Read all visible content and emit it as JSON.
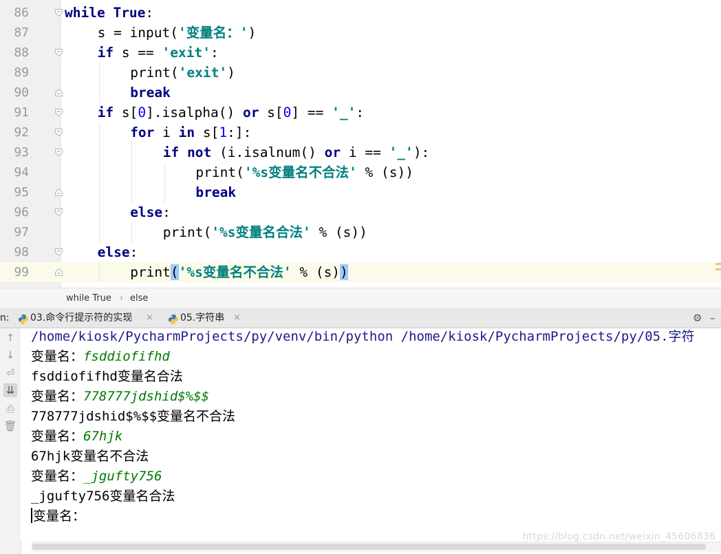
{
  "editor": {
    "current_line": 99,
    "lines": [
      {
        "no": "86",
        "indent": 0,
        "tokens": [
          [
            "kw",
            "while"
          ],
          [
            "t",
            " "
          ],
          [
            "kw",
            "True"
          ],
          [
            "t",
            ":"
          ]
        ]
      },
      {
        "no": "87",
        "indent": 1,
        "tokens": [
          [
            "t",
            "s = input("
          ],
          [
            "str",
            "'变量名：'"
          ],
          [
            "t",
            ")"
          ]
        ]
      },
      {
        "no": "88",
        "indent": 1,
        "tokens": [
          [
            "kw",
            "if"
          ],
          [
            "t",
            " s == "
          ],
          [
            "str",
            "'exit'"
          ],
          [
            "t",
            ":"
          ]
        ]
      },
      {
        "no": "89",
        "indent": 2,
        "tokens": [
          [
            "t",
            "print("
          ],
          [
            "str",
            "'exit'"
          ],
          [
            "t",
            ")"
          ]
        ]
      },
      {
        "no": "90",
        "indent": 2,
        "tokens": [
          [
            "kw",
            "break"
          ]
        ]
      },
      {
        "no": "91",
        "indent": 1,
        "tokens": [
          [
            "kw",
            "if"
          ],
          [
            "t",
            " s["
          ],
          [
            "num",
            "0"
          ],
          [
            "t",
            "].isalpha() "
          ],
          [
            "kw",
            "or"
          ],
          [
            "t",
            " s["
          ],
          [
            "num",
            "0"
          ],
          [
            "t",
            "] == "
          ],
          [
            "str",
            "'_'"
          ],
          [
            "t",
            ":"
          ]
        ]
      },
      {
        "no": "92",
        "indent": 2,
        "tokens": [
          [
            "kw",
            "for"
          ],
          [
            "t",
            " i "
          ],
          [
            "kw",
            "in"
          ],
          [
            "t",
            " s["
          ],
          [
            "num",
            "1"
          ],
          [
            "t",
            ":]:"
          ]
        ]
      },
      {
        "no": "93",
        "indent": 3,
        "tokens": [
          [
            "kw",
            "if"
          ],
          [
            "t",
            " "
          ],
          [
            "kw",
            "not"
          ],
          [
            "t",
            " (i.isalnum() "
          ],
          [
            "kw",
            "or"
          ],
          [
            "t",
            " i == "
          ],
          [
            "str",
            "'_'"
          ],
          [
            "t",
            "):"
          ]
        ]
      },
      {
        "no": "94",
        "indent": 4,
        "tokens": [
          [
            "t",
            "print("
          ],
          [
            "str",
            "'%s变量名不合法'"
          ],
          [
            "t",
            " % (s))"
          ]
        ]
      },
      {
        "no": "95",
        "indent": 4,
        "tokens": [
          [
            "kw",
            "break"
          ]
        ]
      },
      {
        "no": "96",
        "indent": 2,
        "tokens": [
          [
            "kw",
            "else"
          ],
          [
            "t",
            ":"
          ]
        ]
      },
      {
        "no": "97",
        "indent": 3,
        "tokens": [
          [
            "t",
            "print("
          ],
          [
            "str",
            "'%s变量名合法'"
          ],
          [
            "t",
            " % (s))"
          ]
        ]
      },
      {
        "no": "98",
        "indent": 1,
        "tokens": [
          [
            "kw",
            "else"
          ],
          [
            "t",
            ":"
          ]
        ]
      },
      {
        "no": "99",
        "indent": 2,
        "tokens": [
          [
            "t",
            "print"
          ],
          [
            "hl",
            "("
          ],
          [
            "str",
            "'%s变量名不合法'"
          ],
          [
            "t",
            " % (s)"
          ],
          [
            "hl",
            ")"
          ]
        ]
      }
    ]
  },
  "breadcrumb": {
    "items": [
      "while True",
      "else"
    ],
    "separator": "›"
  },
  "run_tabs": {
    "prefix": "n:",
    "tabs": [
      {
        "label": "03.命令行提示符的实现",
        "close": "×"
      },
      {
        "label": "05.字符串",
        "close": "×"
      }
    ],
    "settings_glyph": "⚙",
    "minimize_glyph": "–"
  },
  "console": {
    "lines": [
      {
        "kind": "cmd",
        "text": "/home/kiosk/PycharmProjects/py/venv/bin/python /home/kiosk/PycharmProjects/py/05.字符"
      },
      {
        "kind": "prompt",
        "text": "变量名：",
        "input": "fsddiofifhd"
      },
      {
        "kind": "out",
        "text": "fsddiofifhd变量名合法"
      },
      {
        "kind": "prompt",
        "text": "变量名：",
        "input": "778777jdshid$%$$"
      },
      {
        "kind": "out",
        "text": "778777jdshid$%$$变量名不合法"
      },
      {
        "kind": "prompt",
        "text": "变量名：",
        "input": "67hjk"
      },
      {
        "kind": "out",
        "text": "67hjk变量名不合法"
      },
      {
        "kind": "prompt",
        "text": "变量名：",
        "input": "_jgufty756"
      },
      {
        "kind": "out",
        "text": "_jgufty756变量名合法"
      },
      {
        "kind": "prompt_caret",
        "text": "变量名：",
        "input": ""
      }
    ]
  },
  "toolbar_icons": [
    {
      "name": "up-arrow-icon",
      "glyph": "↑"
    },
    {
      "name": "down-arrow-icon",
      "glyph": "↓"
    },
    {
      "name": "soft-wrap-icon",
      "glyph": "⏎"
    },
    {
      "name": "scroll-to-end-icon",
      "glyph": "⇊"
    },
    {
      "name": "print-icon",
      "glyph": "⎙"
    },
    {
      "name": "trash-icon",
      "glyph": "🗑"
    }
  ],
  "watermark": "https://blog.csdn.net/weixin_45606836",
  "colors": {
    "keyword": "#000080",
    "string": "#008080",
    "number": "#0000ff",
    "input_echo": "#007a00",
    "current_line_bg": "#fcfae8",
    "bracket_highlight": "#99ccff"
  }
}
